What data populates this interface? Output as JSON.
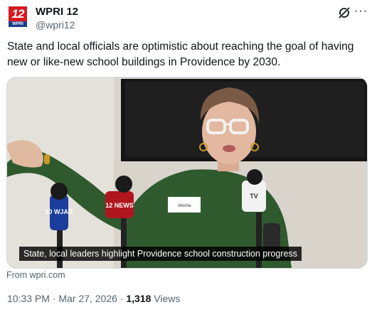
{
  "account": {
    "name": "WPRI 12",
    "handle": "@wpri12",
    "avatar_number": "12",
    "avatar_label": "WPRI"
  },
  "tweet": {
    "text": "State and local officials are optimistic about reaching the goal of having new or like-new school buildings in Providence by 2030.",
    "video_caption": "State, local leaders highlight Providence school construction progress",
    "source": "From wpri.com",
    "time": "10:33 PM",
    "date": "Mar 27, 2026",
    "views_count": "1,318",
    "views_label": "Views"
  },
  "mic_flags": {
    "left": "10 WJAR",
    "center": "12 NEWS",
    "right": "TV"
  },
  "name_tag": "Ahisha",
  "colors": {
    "brand_red": "#d71920",
    "brand_blue": "#1b3f8b",
    "text": "#0f1419",
    "muted": "#536471"
  },
  "icons": [
    "grok-icon",
    "more-icon"
  ]
}
